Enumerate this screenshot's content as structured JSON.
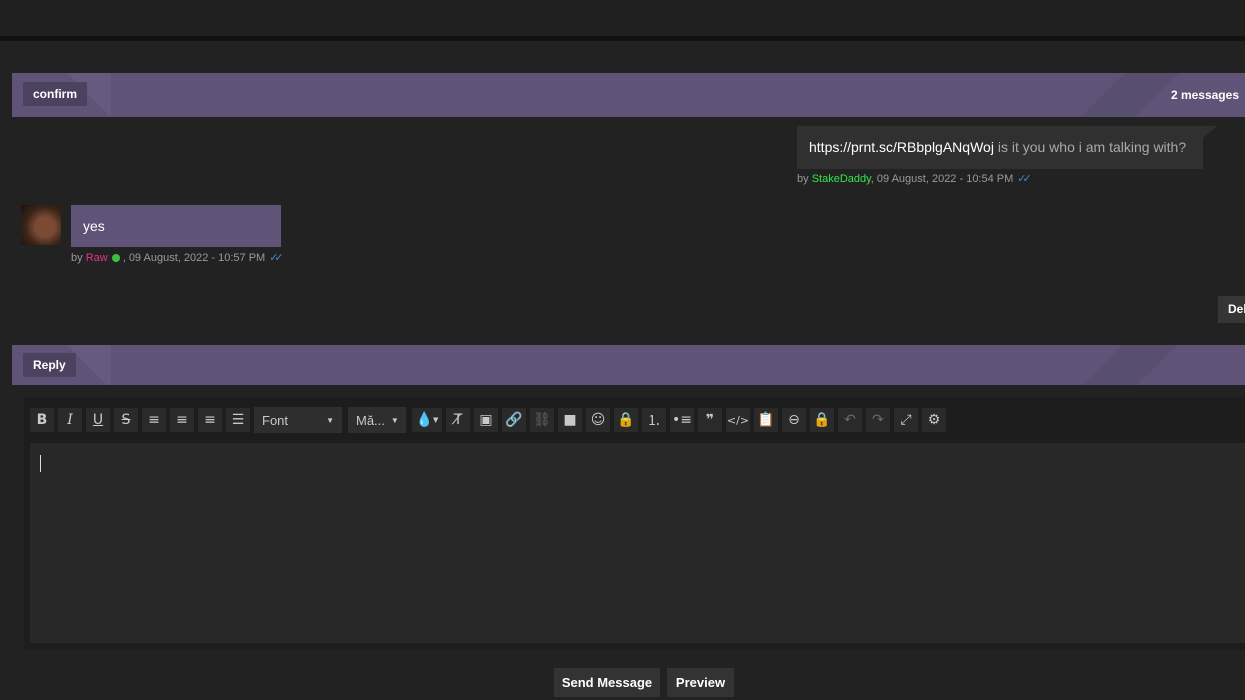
{
  "conversation": {
    "title": "confirm",
    "message_count": "2 messages"
  },
  "messages": [
    {
      "link": "https://prnt.sc/RBbplgANqWoj",
      "text": " is it you who i am talking with?",
      "meta_prefix": "by ",
      "author": "StakeDaddy",
      "timestamp": ", 09 August, 2022 - 10:54 PM"
    },
    {
      "text": "yes",
      "meta_prefix": "by ",
      "author": "Raw",
      "timestamp": ", 09 August, 2022 - 10:57 PM"
    }
  ],
  "delete_button": "Del",
  "reply": {
    "title": "Reply",
    "font_label": "Font",
    "size_label": "Mă...",
    "send_button": "Send Message",
    "preview_button": "Preview"
  },
  "colors": {
    "band": "#5f5478",
    "author_green": "#33e64b",
    "author_pink": "#e0348c",
    "read_ticks": "#3c8ad8"
  },
  "toolbar_icons": [
    "bold-icon",
    "italic-icon",
    "underline-icon",
    "strikethrough-icon",
    "align-left-icon",
    "align-center-icon",
    "align-right-icon",
    "justify-icon",
    "color-icon",
    "remove-format-icon",
    "image-icon",
    "link-icon",
    "unlink-icon",
    "video-icon",
    "emoji-icon",
    "lock-icon",
    "ordered-list-icon",
    "bullet-list-icon",
    "quote-icon",
    "code-icon",
    "paste-icon",
    "minus-icon",
    "lock-icon",
    "undo-icon",
    "redo-icon",
    "maximize-icon",
    "settings-icon"
  ]
}
